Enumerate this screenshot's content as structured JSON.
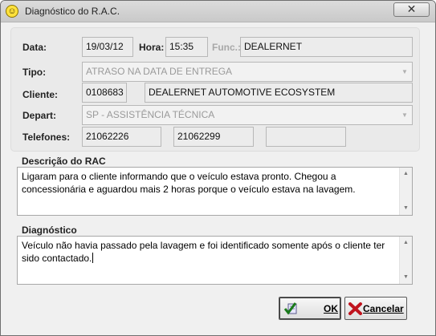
{
  "window": {
    "title": "Diagnóstico do R.A.C.",
    "close_label": "✕",
    "app_icon_glyph": "☺",
    "app_icon_name": "smiley-icon"
  },
  "header": {
    "data_label": "Data:",
    "data_value": "19/03/12",
    "hora_label": "Hora:",
    "hora_value": "15:35",
    "func_label": "Func.:",
    "func_value": "DEALERNET",
    "tipo_label": "Tipo:",
    "tipo_value": "ATRASO NA DATA DE ENTREGA",
    "cliente_label": "Cliente:",
    "cliente_code": "0108683",
    "cliente_name": "DEALERNET AUTOMOTIVE ECOSYSTEM",
    "depart_label": "Depart:",
    "depart_value": "SP - ASSISTÊNCIA TÉCNICA",
    "telefones_label": "Telefones:",
    "telefone_1": "21062226",
    "telefone_2": "21062299",
    "telefone_3": ""
  },
  "descricao": {
    "label": "Descrição do RAC",
    "line_1": "Ligaram para o cliente informando que o veículo estava pronto. Chegou a",
    "line_2": "concessionária e aguardou mais 2 horas porque o veículo estava na lavagem."
  },
  "diagnostico": {
    "label": "Diagnóstico",
    "line_1": "Veículo não havia passado pela lavagem e foi identificado somente após o cliente ter",
    "line_2": "sido contactado."
  },
  "buttons": {
    "ok_label": "OK",
    "cancel_label": "Cancelar"
  },
  "colors": {
    "ok_check": "#1a7a1a",
    "cancel_x": "#c0141e"
  }
}
